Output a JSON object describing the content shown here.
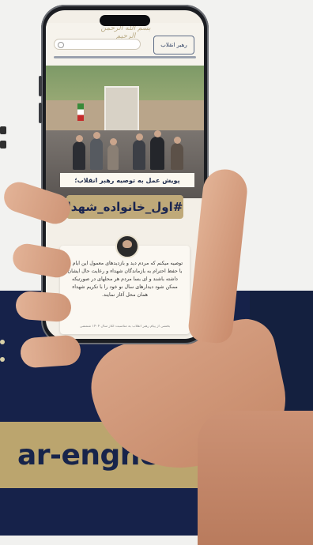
{
  "site": {
    "domain_text": "ar-enghelab.ir",
    "signature": "بسم الله الرحمن الرحیم",
    "logo_text": "رهبر انقلاب",
    "search_placeholder": "جستجو"
  },
  "post": {
    "headline": "پویش عمل به توصیه رهبر انقلاب؛",
    "hashtag": "#اول_خانواده_شهدا",
    "quote": "توصیه میکنم که مردم دید و بازدیدهای معمول این ایام را با حفظ احترام به بازماندگان شهداء و رعایت حال ایشان داشته باشند و ای بسا مردم هر محلهای در صورتیکه ممکن شود دیدارهای سال نو خود را با تکریم شهداء همان محل آغاز نمایند.",
    "footnote": "بخشی از پیام رهبر انقلاب به مناسبت آغاز سال ۱۴۰۴ شمسی"
  },
  "colors": {
    "navy": "#16224a",
    "gold": "#bba56e"
  }
}
